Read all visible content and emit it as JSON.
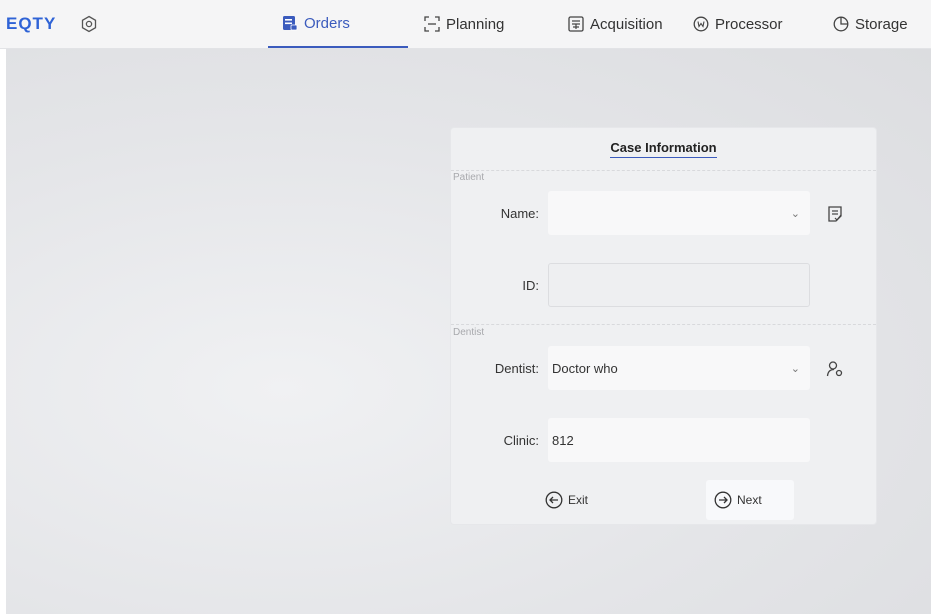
{
  "header": {
    "logo": "EQTY",
    "tabs": [
      {
        "label": "Orders",
        "active": true
      },
      {
        "label": "Planning"
      },
      {
        "label": "Acquisition"
      },
      {
        "label": "Processor"
      },
      {
        "label": "Storage"
      }
    ]
  },
  "form": {
    "title": "Case Information",
    "patient_section": "Patient",
    "dentist_section": "Dentist",
    "name_label": "Name:",
    "name_value": "",
    "id_label": "ID:",
    "id_value": "",
    "dentist_label": "Dentist:",
    "dentist_value": "Doctor who",
    "clinic_label": "Clinic:",
    "clinic_value": "812",
    "exit_label": "Exit",
    "next_label": "Next"
  },
  "colors": {
    "accent": "#3b5bbd",
    "logo": "#2f63d6"
  }
}
